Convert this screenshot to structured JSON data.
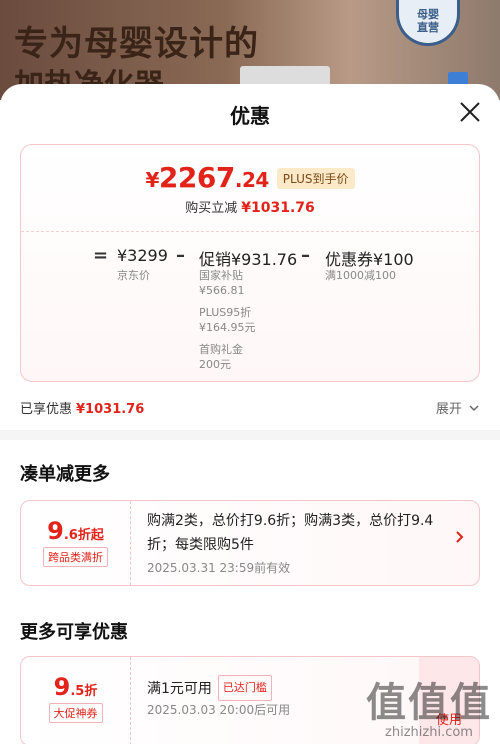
{
  "banner": {
    "line1": "专为母婴设计的",
    "line2": "加热净化器",
    "badge": "母婴\n直营",
    "brand_color": "#3b5f8a"
  },
  "sheet": {
    "title": "优惠",
    "close_icon": "close-icon"
  },
  "summary": {
    "yen": "¥",
    "price_int": "2267",
    "price_dec": ".24",
    "plus_tag": "PLUS到手价",
    "save_label": "购买立减",
    "save_amount": "¥1031.76",
    "accent": "#e2231a"
  },
  "calc": {
    "eq": "=",
    "minus": "–",
    "jd_price": "¥3299",
    "jd_label": "京东价",
    "promo": "促销¥931.76",
    "promo_items": [
      {
        "name": "国家补贴",
        "value": "¥566.81"
      },
      {
        "name": "PLUS95折",
        "value": "¥164.95元"
      },
      {
        "name": "首购礼金",
        "value": "200元"
      }
    ],
    "coupon": "优惠券¥100",
    "coupon_desc": "满1000减100"
  },
  "enjoyed": {
    "label": "已享优惠",
    "amount": "¥1031.76",
    "expand_label": "展开"
  },
  "section1": {
    "title": "凑单减更多",
    "coupon": {
      "rate_int": "9",
      "rate_dec": ".6",
      "rate_suffix": "折起",
      "tag": "跨品类满折",
      "text": "购满2类，总价打9.6折；购满3类，总价打9.4折；每类限购5件",
      "time": "2025.03.31  23:59前有效"
    }
  },
  "section2": {
    "title": "更多可享优惠",
    "coupon": {
      "rate_int": "9",
      "rate_dec": ".5",
      "rate_suffix": "折",
      "tag": "大促神券",
      "text": "满1元可用",
      "mini_tag": "已达门槛",
      "time": "2025.03.03  20:00后可用",
      "use_label": "使用"
    }
  },
  "watermark": {
    "logo": "值值值",
    "url": "zhizhizhi.com"
  }
}
